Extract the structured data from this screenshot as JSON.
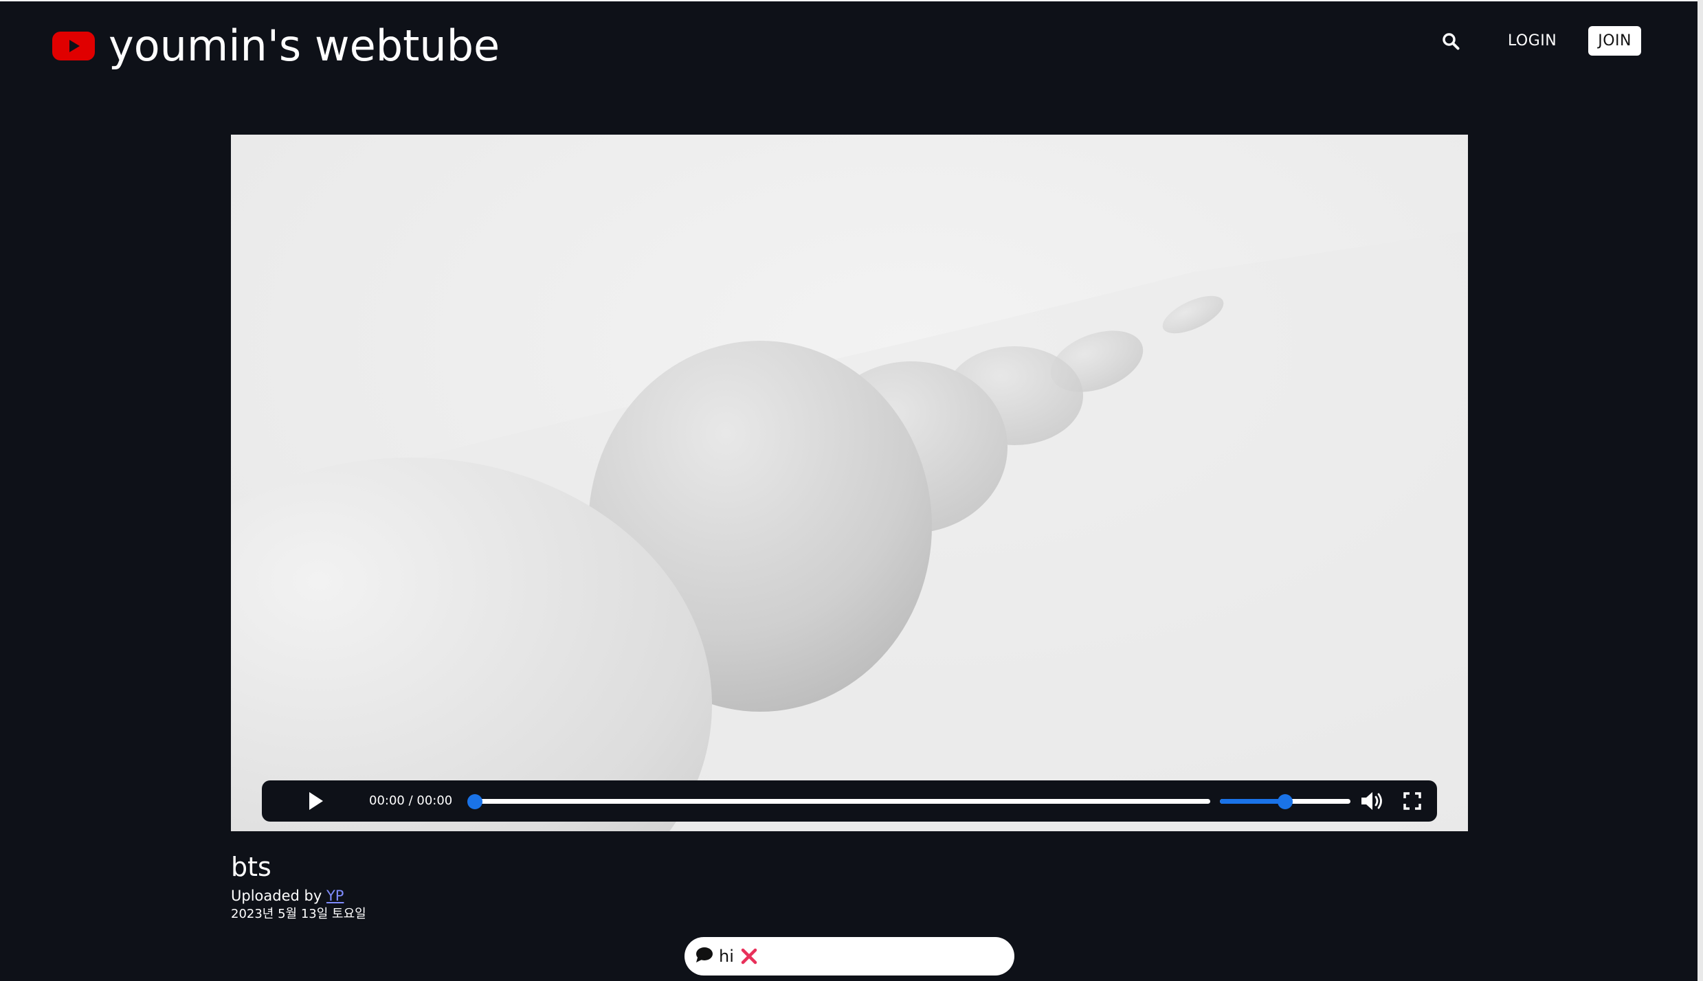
{
  "header": {
    "site_title": "youmin's webtube",
    "login_label": "LOGIN",
    "join_label": "JOIN",
    "logo_icon": "youtube-logo-icon",
    "search_icon": "search-icon",
    "brand_color": "#e00000"
  },
  "video": {
    "time_display": "00:00 / 00:00",
    "progress": 0,
    "volume": 0.5,
    "accent_color": "#1a73e8",
    "play_icon": "play-icon",
    "mute_icon": "volume-icon",
    "fullscreen_icon": "fullscreen-icon"
  },
  "meta": {
    "title": "bts",
    "uploaded_by_prefix": "Uploaded by ",
    "uploader": "YP",
    "date": "2023년 5월 13일 토요일"
  },
  "comments": [
    {
      "icon": "comment-icon",
      "text": "hi",
      "delete_icon": "delete-x-icon",
      "delete_color": "#e8305a"
    }
  ]
}
